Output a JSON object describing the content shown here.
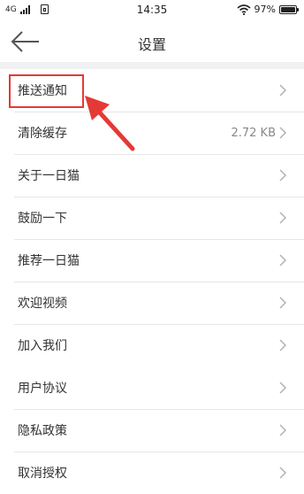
{
  "status_bar": {
    "network": "4G",
    "time": "14:35",
    "battery_percent": "97%",
    "battery_level": 0.97
  },
  "nav": {
    "title": "设置"
  },
  "groups": [
    {
      "items": [
        {
          "label": "推送通知"
        },
        {
          "label": "清除缓存",
          "value": "2.72 KB"
        },
        {
          "label": "关于一日猫"
        },
        {
          "label": "鼓励一下"
        },
        {
          "label": "推荐一日猫"
        },
        {
          "label": "欢迎视频"
        },
        {
          "label": "加入我们"
        }
      ]
    },
    {
      "items": [
        {
          "label": "用户协议"
        },
        {
          "label": "隐私政策"
        },
        {
          "label": "取消授权"
        }
      ]
    }
  ],
  "colors": {
    "accent": "#e53935",
    "background": "#f1f1f3",
    "chevron": "#b3b3b3"
  },
  "icons": {
    "back": "arrow-left-icon",
    "row": "chevron-right-icon",
    "wifi": "wifi-icon",
    "battery": "battery-icon",
    "signal": "signal-icon",
    "sim": "sim-card-icon",
    "annotation": "red-arrow-icon"
  }
}
